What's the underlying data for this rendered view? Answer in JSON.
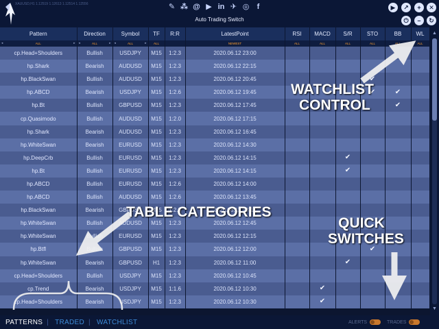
{
  "ticker": "XAUUSD,H1  1.12519 1.12613 1.12514 1.12556",
  "auto_trading_switch": "Auto Trading Switch",
  "social_icons": [
    "brush-icon",
    "network-icon",
    "at-icon",
    "youtube-icon",
    "linkedin-icon",
    "twitter-icon",
    "instagram-icon",
    "facebook-icon"
  ],
  "controls": {
    "top_row": [
      "play-icon",
      "chart-icon",
      "add-icon",
      "close-icon"
    ],
    "second_row": [
      "power-icon",
      "minimize-icon",
      "refresh-icon"
    ]
  },
  "table": {
    "headers": [
      "Pattern",
      "Direction",
      "Symbol",
      "TF",
      "R:R",
      "LatestPoint",
      "RSI",
      "MACD",
      "S/R",
      "STO",
      "BB",
      "WL"
    ],
    "filters": [
      "ALL",
      "ALL",
      "ALL",
      "ALL",
      "",
      "NEWEST",
      "ALL",
      "ALL",
      "ALL",
      "ALL",
      "ALL",
      "ALL"
    ],
    "rows": [
      {
        "pattern": "cp.Head+Shoulders",
        "direction": "Bullish",
        "symbol": "USDJPY",
        "tf": "M15",
        "rr": "1:2.3",
        "latest": "2020.06.12 23:00",
        "rsi": "",
        "macd": "",
        "sr": "",
        "sto": "",
        "bb": "",
        "wl": ""
      },
      {
        "pattern": "hp.Shark",
        "direction": "Bearish",
        "symbol": "AUDUSD",
        "tf": "M15",
        "rr": "1:2.3",
        "latest": "2020.06.12 22:15",
        "rsi": "",
        "macd": "",
        "sr": "",
        "sto": "",
        "bb": "",
        "wl": ""
      },
      {
        "pattern": "hp.BlackSwan",
        "direction": "Bullish",
        "symbol": "AUDUSD",
        "tf": "M15",
        "rr": "1:2.3",
        "latest": "2020.06.12 20:45",
        "rsi": "",
        "macd": "",
        "sr": "",
        "sto": "✔",
        "bb": "",
        "wl": ""
      },
      {
        "pattern": "hp.ABCD",
        "direction": "Bearish",
        "symbol": "USDJPY",
        "tf": "M15",
        "rr": "1:2.6",
        "latest": "2020.06.12 19:45",
        "rsi": "",
        "macd": "",
        "sr": "",
        "sto": "✔",
        "bb": "✔",
        "wl": ""
      },
      {
        "pattern": "hp.Bt",
        "direction": "Bullish",
        "symbol": "GBPUSD",
        "tf": "M15",
        "rr": "1:2.3",
        "latest": "2020.06.12 17:45",
        "rsi": "",
        "macd": "",
        "sr": "",
        "sto": "",
        "bb": "✔",
        "wl": ""
      },
      {
        "pattern": "cp.Quasimodo",
        "direction": "Bullish",
        "symbol": "AUDUSD",
        "tf": "M15",
        "rr": "1:2.0",
        "latest": "2020.06.12 17:15",
        "rsi": "",
        "macd": "",
        "sr": "",
        "sto": "",
        "bb": "",
        "wl": ""
      },
      {
        "pattern": "hp.Shark",
        "direction": "Bearish",
        "symbol": "AUDUSD",
        "tf": "M15",
        "rr": "1:2.3",
        "latest": "2020.06.12 16:45",
        "rsi": "",
        "macd": "",
        "sr": "",
        "sto": "",
        "bb": "",
        "wl": ""
      },
      {
        "pattern": "hp.WhiteSwan",
        "direction": "Bearish",
        "symbol": "EURUSD",
        "tf": "M15",
        "rr": "1:2.3",
        "latest": "2020.06.12 14:30",
        "rsi": "",
        "macd": "",
        "sr": "",
        "sto": "",
        "bb": "",
        "wl": ""
      },
      {
        "pattern": "hp.DeepCrb",
        "direction": "Bullish",
        "symbol": "EURUSD",
        "tf": "M15",
        "rr": "1:2.3",
        "latest": "2020.06.12 14:15",
        "rsi": "",
        "macd": "",
        "sr": "✔",
        "sto": "",
        "bb": "",
        "wl": ""
      },
      {
        "pattern": "hp.Bt",
        "direction": "Bullish",
        "symbol": "EURUSD",
        "tf": "M15",
        "rr": "1:2.3",
        "latest": "2020.06.12 14:15",
        "rsi": "",
        "macd": "",
        "sr": "✔",
        "sto": "",
        "bb": "",
        "wl": ""
      },
      {
        "pattern": "hp.ABCD",
        "direction": "Bullish",
        "symbol": "EURUSD",
        "tf": "M15",
        "rr": "1:2.6",
        "latest": "2020.06.12 14:00",
        "rsi": "",
        "macd": "",
        "sr": "",
        "sto": "",
        "bb": "",
        "wl": ""
      },
      {
        "pattern": "hp.ABCD",
        "direction": "Bullish",
        "symbol": "AUDUSD",
        "tf": "M15",
        "rr": "1:2.6",
        "latest": "2020.06.12 13:45",
        "rsi": "",
        "macd": "",
        "sr": "",
        "sto": "",
        "bb": "",
        "wl": ""
      },
      {
        "pattern": "hp.BlackSwan",
        "direction": "Bearish",
        "symbol": "GBPUSD",
        "tf": "M15",
        "rr": "1:2.3",
        "latest": "2020.06.12 13:15",
        "rsi": "",
        "macd": "",
        "sr": "",
        "sto": "",
        "bb": "",
        "wl": ""
      },
      {
        "pattern": "hp.WhiteSwan",
        "direction": "Bullish",
        "symbol": "AUDUSD",
        "tf": "M15",
        "rr": "1:2.3",
        "latest": "2020.06.12 12:45",
        "rsi": "",
        "macd": "",
        "sr": "",
        "sto": "",
        "bb": "",
        "wl": ""
      },
      {
        "pattern": "hp.WhiteSwan",
        "direction": "Bullish",
        "symbol": "EURUSD",
        "tf": "M15",
        "rr": "1:2.3",
        "latest": "2020.06.12 12:15",
        "rsi": "",
        "macd": "",
        "sr": "",
        "sto": "",
        "bb": "",
        "wl": ""
      },
      {
        "pattern": "hp.Btfl",
        "direction": "Bullish",
        "symbol": "GBPUSD",
        "tf": "M15",
        "rr": "1:2.3",
        "latest": "2020.06.12 12:00",
        "rsi": "",
        "macd": "",
        "sr": "",
        "sto": "✔",
        "bb": "",
        "wl": ""
      },
      {
        "pattern": "hp.WhiteSwan",
        "direction": "Bearish",
        "symbol": "GBPUSD",
        "tf": "H1",
        "rr": "1:2.3",
        "latest": "2020.06.12 11:00",
        "rsi": "",
        "macd": "",
        "sr": "✔",
        "sto": "",
        "bb": "",
        "wl": ""
      },
      {
        "pattern": "cp.Head+Shoulders",
        "direction": "Bullish",
        "symbol": "USDJPY",
        "tf": "M15",
        "rr": "1:2.3",
        "latest": "2020.06.12 10:45",
        "rsi": "",
        "macd": "",
        "sr": "",
        "sto": "",
        "bb": "",
        "wl": ""
      },
      {
        "pattern": "cp.Trend",
        "direction": "Bearish",
        "symbol": "USDJPY",
        "tf": "M15",
        "rr": "1:1.6",
        "latest": "2020.06.12 10:30",
        "rsi": "",
        "macd": "✔",
        "sr": "",
        "sto": "",
        "bb": "",
        "wl": ""
      },
      {
        "pattern": "cp.Head+Shoulders",
        "direction": "Bearish",
        "symbol": "USDJPY",
        "tf": "M15",
        "rr": "1:2.3",
        "latest": "2020.06.12 10:30",
        "rsi": "",
        "macd": "✔",
        "sr": "",
        "sto": "",
        "bb": "",
        "wl": ""
      }
    ]
  },
  "bottom": {
    "tabs": [
      "PATTERNS",
      "TRADED",
      "WATCHLIST"
    ],
    "separator": "|",
    "alerts_label": "ALERTS",
    "trades_label": "TRADES"
  },
  "annotations": {
    "watchlist_line1": "WATCHLIST",
    "watchlist_line2": "CONTROL",
    "table_categories": "TABLE CATEGORIES",
    "quick_line1": "QUICK",
    "quick_line2": "SWITCHES"
  }
}
